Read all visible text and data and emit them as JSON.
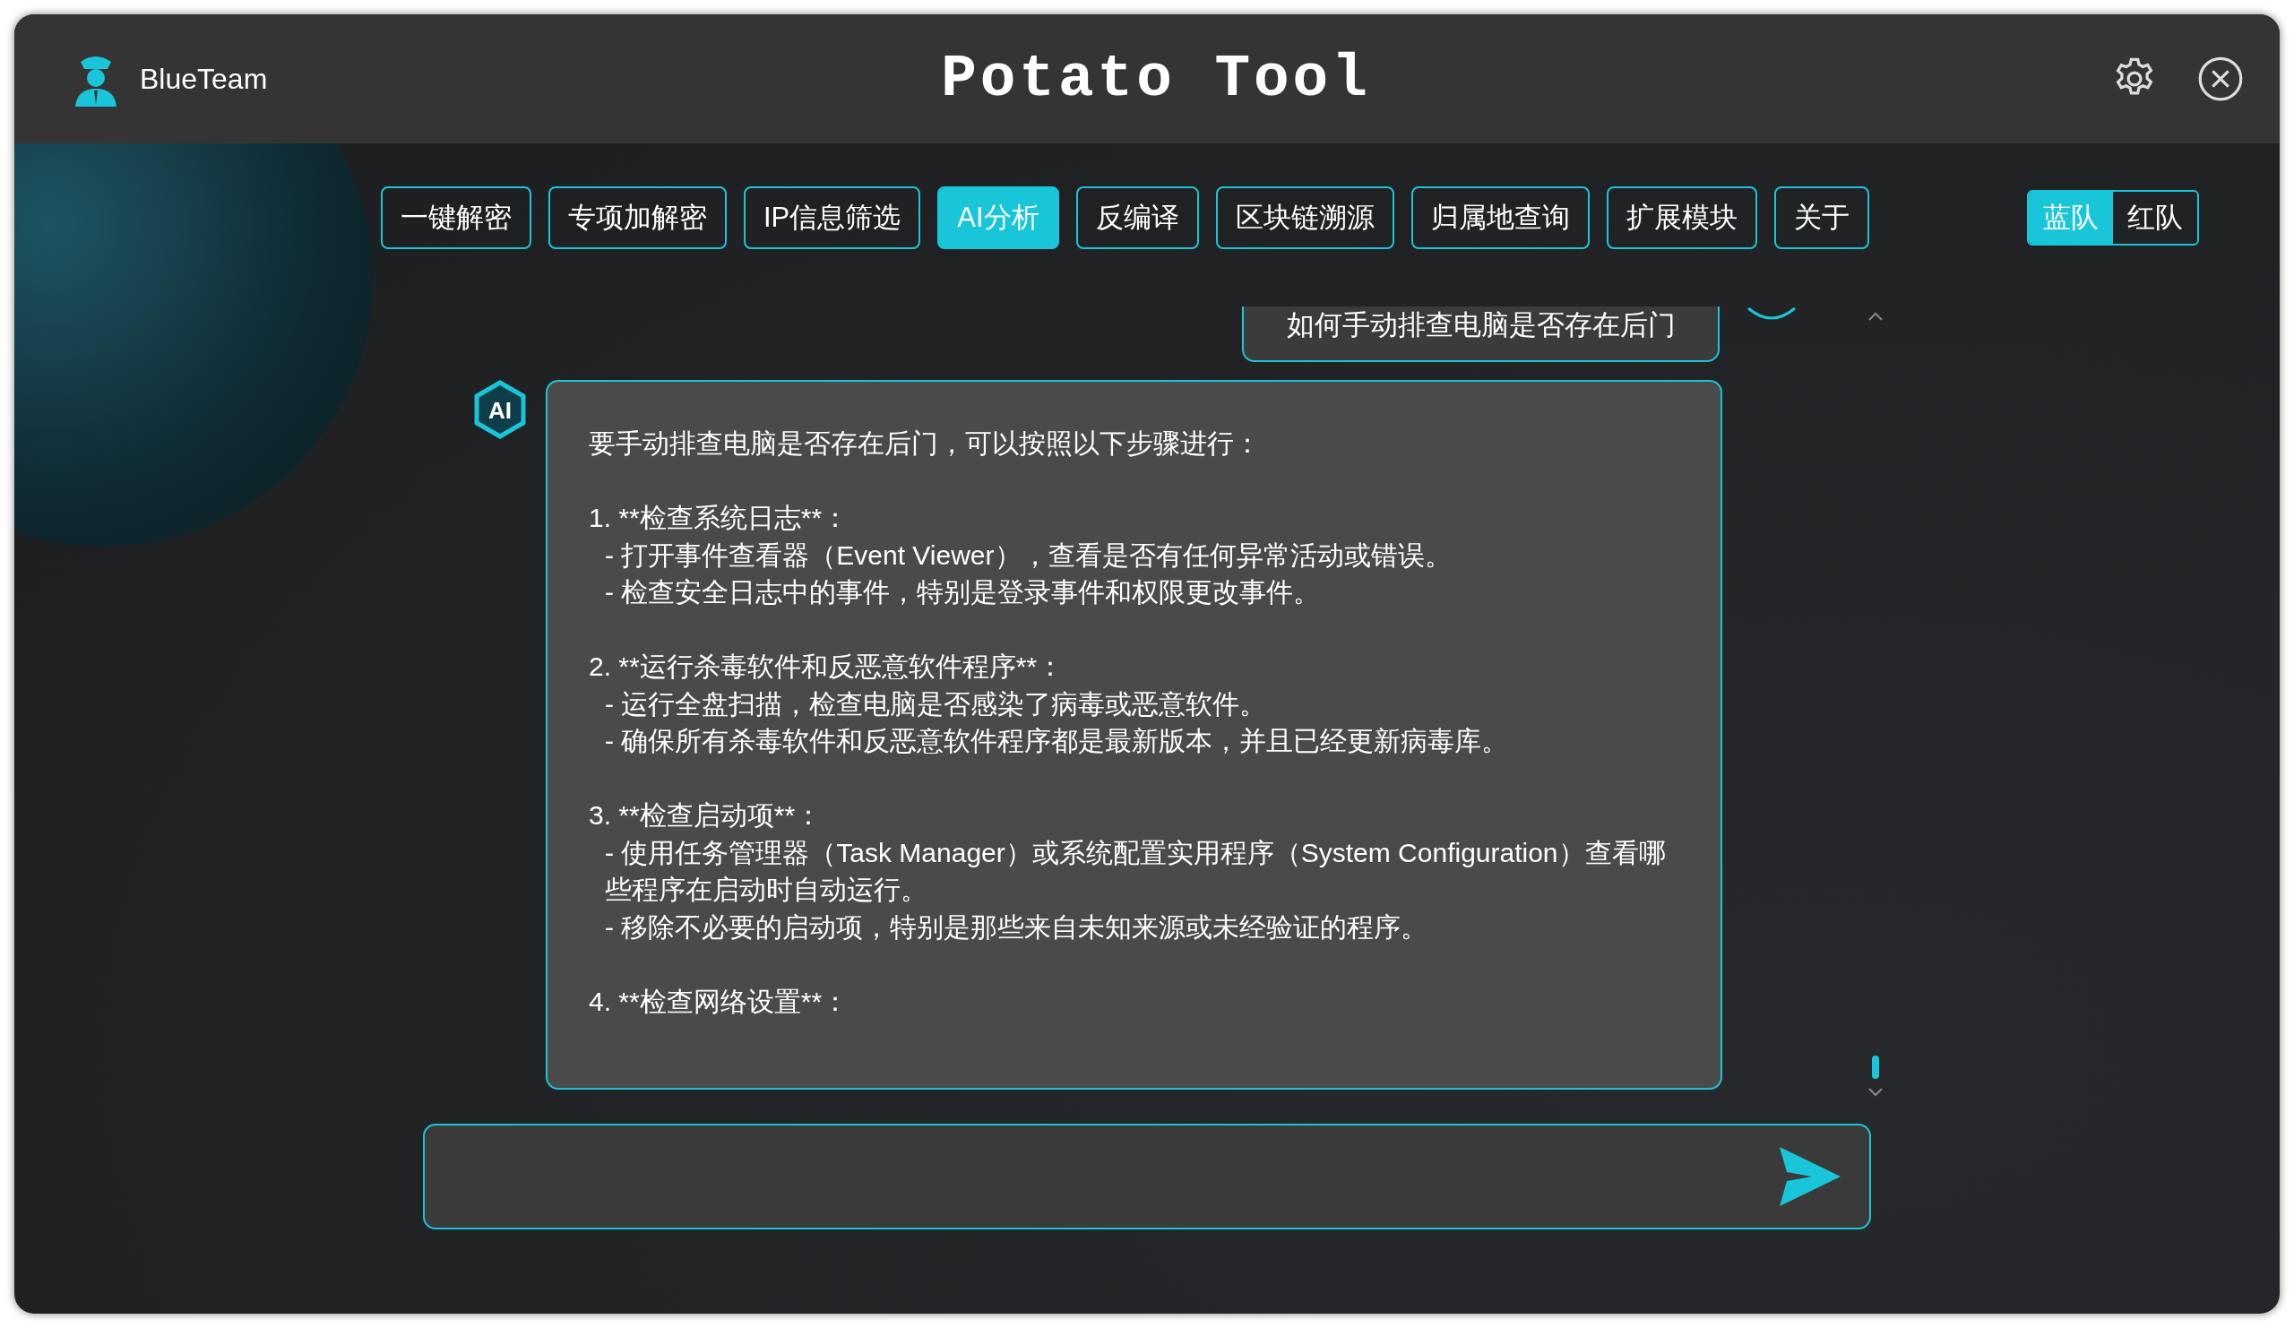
{
  "header": {
    "brand": "BlueTeam",
    "title": "Potato Tool"
  },
  "tabs": [
    {
      "label": "一键解密",
      "selected": false
    },
    {
      "label": "专项加解密",
      "selected": false
    },
    {
      "label": "IP信息筛选",
      "selected": false
    },
    {
      "label": "AI分析",
      "selected": true
    },
    {
      "label": "反编译",
      "selected": false
    },
    {
      "label": "区块链溯源",
      "selected": false
    },
    {
      "label": "归属地查询",
      "selected": false
    },
    {
      "label": "扩展模块",
      "selected": false
    },
    {
      "label": "关于",
      "selected": false
    }
  ],
  "team_toggle": [
    {
      "label": "蓝队",
      "selected": true
    },
    {
      "label": "红队",
      "selected": false
    }
  ],
  "chat": {
    "ai_badge": "AI",
    "user_message": "如何手动排查电脑是否存在后门",
    "ai_reply": [
      [
        {
          "kind": "text",
          "text": "要手动排查电脑是否存在后门，可以按照以下步骤进行："
        }
      ],
      [
        {
          "kind": "text",
          "text": "1. **检查系统日志**："
        },
        {
          "kind": "item",
          "text": "- 打开事件查看器（Event Viewer），查看是否有任何异常活动或错误。"
        },
        {
          "kind": "item",
          "text": "- 检查安全日志中的事件，特别是登录事件和权限更改事件。"
        }
      ],
      [
        {
          "kind": "text",
          "text": "2. **运行杀毒软件和反恶意软件程序**："
        },
        {
          "kind": "item",
          "text": "- 运行全盘扫描，检查电脑是否感染了病毒或恶意软件。"
        },
        {
          "kind": "item",
          "text": "- 确保所有杀毒软件和反恶意软件程序都是最新版本，并且已经更新病毒库。"
        }
      ],
      [
        {
          "kind": "text",
          "text": "3. **检查启动项**："
        },
        {
          "kind": "item",
          "text": "- 使用任务管理器（Task Manager）或系统配置实用程序（System Configuration）查看哪些程序在启动时自动运行。"
        },
        {
          "kind": "item",
          "text": "- 移除不必要的启动项，特别是那些来自未知来源或未经验证的程序。"
        }
      ],
      [
        {
          "kind": "text",
          "text": "4. **检查网络设置**："
        }
      ]
    ]
  }
}
